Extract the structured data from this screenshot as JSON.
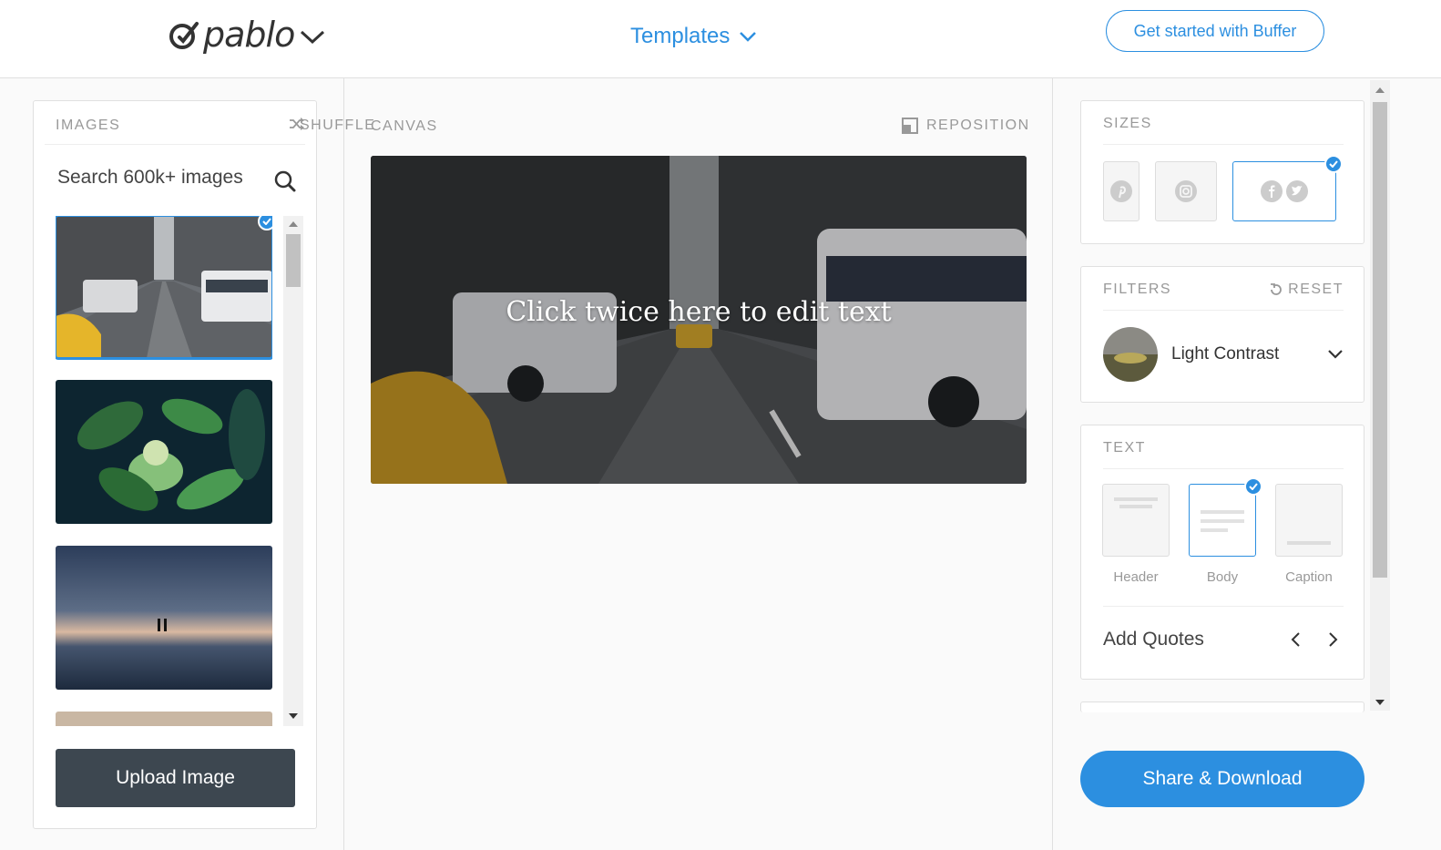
{
  "header": {
    "logo_text": "pablo",
    "templates_label": "Templates",
    "cta_label": "Get started with Buffer"
  },
  "images_panel": {
    "title": "IMAGES",
    "shuffle_label": "SHUFFLE",
    "search_placeholder": "Search 600k+ images",
    "upload_label": "Upload Image"
  },
  "canvas": {
    "title": "CANVAS",
    "reposition_label": "REPOSITION",
    "overlay_text": "Click twice here to edit text"
  },
  "sizes": {
    "title": "SIZES",
    "options": [
      "pinterest",
      "instagram",
      "facebook-twitter"
    ],
    "selected": "facebook-twitter"
  },
  "filters": {
    "title": "FILTERS",
    "reset_label": "RESET",
    "selected_filter": "Light Contrast"
  },
  "text": {
    "title": "TEXT",
    "options": [
      {
        "label": "Header"
      },
      {
        "label": "Body"
      },
      {
        "label": "Caption"
      }
    ],
    "selected": "Body",
    "add_quotes_label": "Add Quotes"
  },
  "share_label": "Share & Download",
  "colors": {
    "accent": "#2c8fe0",
    "upload_bg": "#3d4750"
  }
}
